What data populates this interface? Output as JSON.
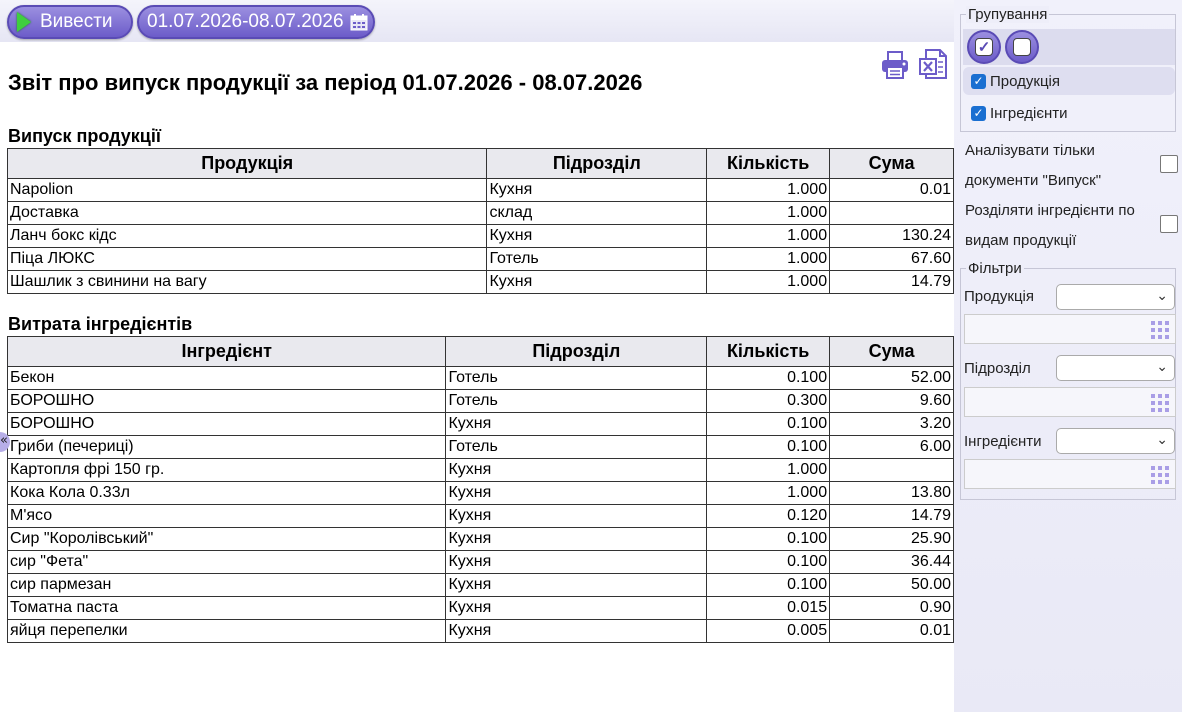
{
  "toolbar": {
    "run_label": "Вивести",
    "date_range": "01.07.2026-08.07.2026"
  },
  "report": {
    "title": "Звіт про випуск продукції за період 01.07.2026 - 08.07.2026",
    "output": {
      "section_title": "Випуск продукції",
      "headers": [
        "Продукція",
        "Підрозділ",
        "Кількість",
        "Сума"
      ],
      "rows": [
        [
          "Napolion",
          "Кухня",
          "1.000",
          "0.01"
        ],
        [
          "Доставка",
          "склад",
          "1.000",
          ""
        ],
        [
          "Ланч бокс кідс",
          "Кухня",
          "1.000",
          "130.24"
        ],
        [
          "Піца ЛЮКС",
          "Готель",
          "1.000",
          "67.60"
        ],
        [
          "Шашлик з свинини на вагу",
          "Кухня",
          "1.000",
          "14.79"
        ]
      ]
    },
    "ingredients": {
      "section_title": "Витрата інгредієнтів",
      "headers": [
        "Інгредієнт",
        "Підрозділ",
        "Кількість",
        "Сума"
      ],
      "rows": [
        [
          "Бекон",
          "Готель",
          "0.100",
          "52.00"
        ],
        [
          "БОРОШНО",
          "Готель",
          "0.300",
          "9.60"
        ],
        [
          "БОРОШНО",
          "Кухня",
          "0.100",
          "3.20"
        ],
        [
          "Гриби (печериці)",
          "Готель",
          "0.100",
          "6.00"
        ],
        [
          "Картопля фрі 150 гр.",
          "Кухня",
          "1.000",
          ""
        ],
        [
          "Кока Кола 0.33л",
          "Кухня",
          "1.000",
          "13.80"
        ],
        [
          "М'ясо",
          "Кухня",
          "0.120",
          "14.79"
        ],
        [
          "Сир \"Королівський\"",
          "Кухня",
          "0.100",
          "25.90"
        ],
        [
          "сир \"Фета\"",
          "Кухня",
          "0.100",
          "36.44"
        ],
        [
          "сир пармезан",
          "Кухня",
          "0.100",
          "50.00"
        ],
        [
          "Томатна паста",
          "Кухня",
          "0.015",
          "0.90"
        ],
        [
          "яйця перепелки",
          "Кухня",
          "0.005",
          "0.01"
        ]
      ]
    }
  },
  "sidebar": {
    "grouping": {
      "legend": "Групування",
      "items": [
        {
          "label": "Продукція",
          "checked": true
        },
        {
          "label": "Інгредієнти",
          "checked": true
        }
      ]
    },
    "options": {
      "only_output_docs": "Аналізувати тільки документи \"Випуск\"",
      "split_ingredients": "Розділяти інгредієнти по видам продукції"
    },
    "filters": {
      "legend": "Фільтри",
      "product_label": "Продукція",
      "department_label": "Підрозділ",
      "ingredients_label": "Інгредієнти"
    }
  },
  "colors": {
    "accent": "#6c5cc9",
    "checkbox": "#1a6fd1",
    "header_bg": "#e9e9ee"
  }
}
